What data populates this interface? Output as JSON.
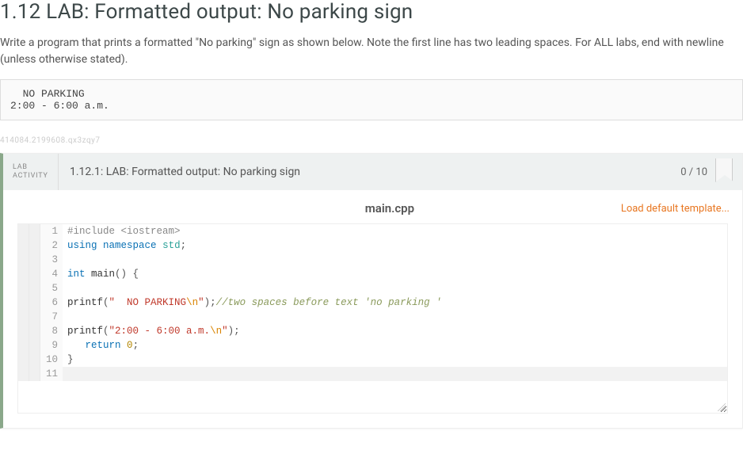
{
  "page": {
    "title": "1.12 LAB: Formatted output: No parking sign",
    "description": "Write a program that prints a formatted \"No parking\" sign as shown below. Note the first line has two leading spaces. For ALL labs, end with newline (unless otherwise stated).",
    "sample_output": "  NO PARKING\n2:00 - 6:00 a.m.",
    "hash_id": "414084.2199608.qx3zqy7"
  },
  "lab": {
    "activity_label_line1": "LAB",
    "activity_label_line2": "ACTIVITY",
    "title": "1.12.1: LAB: Formatted output: No parking sign",
    "score": "0 / 10"
  },
  "editor": {
    "filename": "main.cpp",
    "load_template_label": "Load default template...",
    "lines": [
      {
        "num": 1,
        "hl": false,
        "tokens": [
          [
            "pre",
            "#include <iostream>"
          ]
        ]
      },
      {
        "num": 2,
        "hl": false,
        "tokens": [
          [
            "key",
            "using"
          ],
          [
            "plain",
            " "
          ],
          [
            "key",
            "namespace"
          ],
          [
            "plain",
            " "
          ],
          [
            "ns",
            "std"
          ],
          [
            "punc",
            ";"
          ]
        ]
      },
      {
        "num": 3,
        "hl": false,
        "tokens": []
      },
      {
        "num": 4,
        "hl": false,
        "tokens": [
          [
            "type",
            "int"
          ],
          [
            "plain",
            " "
          ],
          [
            "fn",
            "main"
          ],
          [
            "punc",
            "() {"
          ]
        ]
      },
      {
        "num": 5,
        "hl": false,
        "tokens": []
      },
      {
        "num": 6,
        "hl": false,
        "tokens": [
          [
            "fn",
            "printf"
          ],
          [
            "punc",
            "("
          ],
          [
            "str",
            "\"  NO PARKING"
          ],
          [
            "esc",
            "\\n"
          ],
          [
            "str",
            "\""
          ],
          [
            "punc",
            ");"
          ],
          [
            "comm",
            "//two spaces before text 'no parking '"
          ]
        ]
      },
      {
        "num": 7,
        "hl": false,
        "tokens": []
      },
      {
        "num": 8,
        "hl": false,
        "tokens": [
          [
            "fn",
            "printf"
          ],
          [
            "punc",
            "("
          ],
          [
            "str",
            "\"2:00 - 6:00 a.m."
          ],
          [
            "esc",
            "\\n"
          ],
          [
            "str",
            "\""
          ],
          [
            "punc",
            ");"
          ]
        ]
      },
      {
        "num": 9,
        "hl": false,
        "tokens": [
          [
            "plain",
            "   "
          ],
          [
            "key",
            "return"
          ],
          [
            "plain",
            " "
          ],
          [
            "num",
            "0"
          ],
          [
            "punc",
            ";"
          ]
        ]
      },
      {
        "num": 10,
        "hl": false,
        "tokens": [
          [
            "punc",
            "}"
          ]
        ]
      },
      {
        "num": 11,
        "hl": true,
        "tokens": []
      }
    ]
  }
}
